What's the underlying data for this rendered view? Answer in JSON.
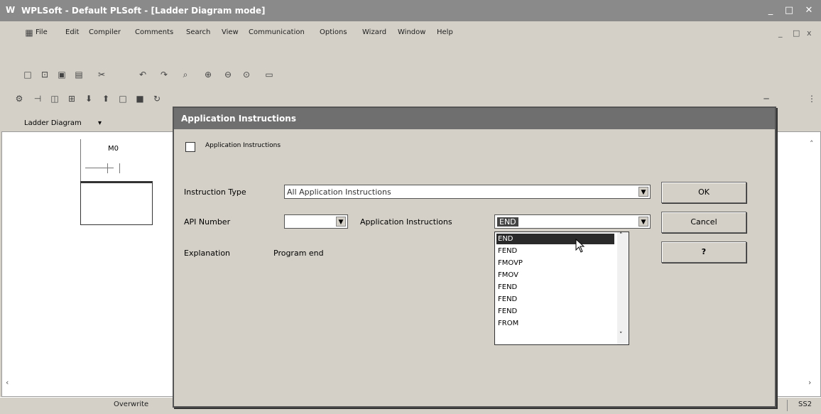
{
  "window": {
    "icon_text": "W",
    "title": "WPLSoft - Default PLSoft - [Ladder Diagram mode]",
    "controls": [
      "_",
      "□",
      "✕"
    ]
  },
  "menubar": {
    "items": [
      "File",
      "Edit",
      "Compiler",
      "Comments",
      "Search",
      "View",
      "Communication",
      "Options",
      "Wizard",
      "Window",
      "Help"
    ],
    "mdi_controls": [
      "_",
      "□",
      "x"
    ]
  },
  "mode": {
    "label": "Ladder Diagram",
    "arrow": "▾"
  },
  "ladder": {
    "contact_label": "M0"
  },
  "dialog": {
    "title": "Application Instructions",
    "checkbox_label": "Application Instructions",
    "instruction_type_label": "Instruction Type",
    "instruction_type_value": "All Application Instructions",
    "api_number_label": "API Number",
    "api_number_value": "",
    "app_instructions_label": "Application Instructions",
    "app_instructions_value": "END",
    "explanation_label": "Explanation",
    "explanation_value": "Program end",
    "buttons": {
      "ok": "OK",
      "cancel": "Cancel",
      "help": "?"
    },
    "dropdown_items": [
      "END",
      "FEND",
      "FMOVP",
      "FMOV",
      "FEND",
      "FEND",
      "FEND",
      "FROM"
    ],
    "selected_index": 0
  },
  "statusbar": {
    "left": "Overwrite",
    "middle": "",
    "right": "SS2"
  }
}
